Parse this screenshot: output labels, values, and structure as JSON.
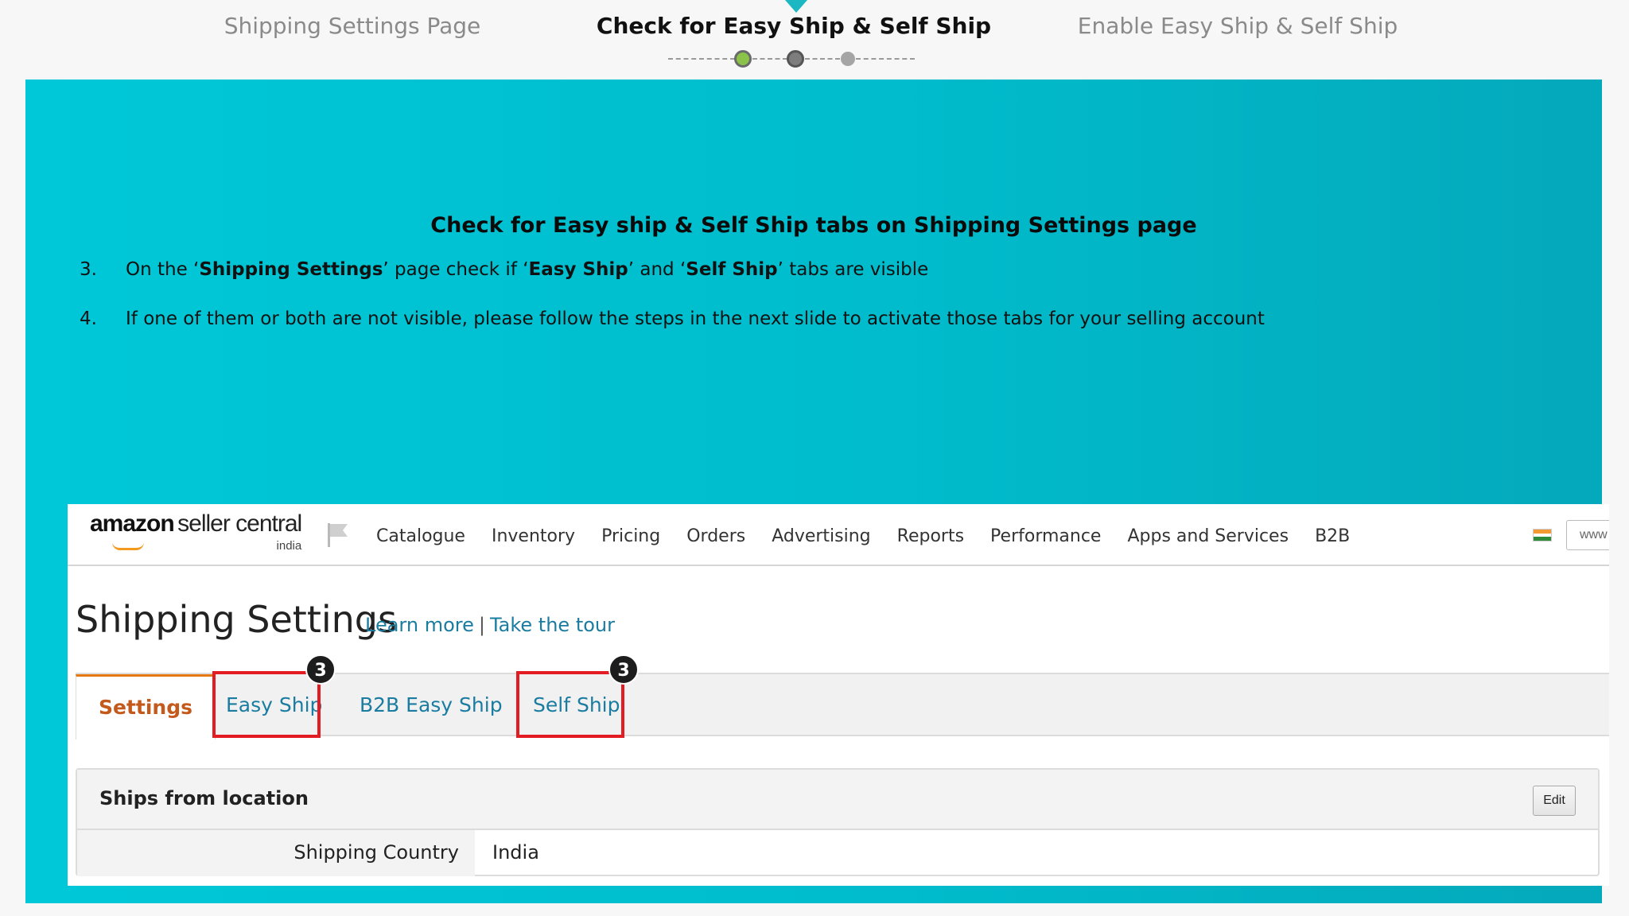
{
  "stepper": {
    "steps": [
      {
        "label": "Shipping Settings Page",
        "state": "done"
      },
      {
        "label": "Check for Easy Ship & Self Ship",
        "state": "current"
      },
      {
        "label": "Enable Easy Ship & Self Ship",
        "state": "todo"
      }
    ]
  },
  "slide": {
    "heading": "Check for Easy ship & Self Ship tabs on Shipping Settings page",
    "instructions": [
      {
        "num": "3.",
        "parts": [
          "On the ‘",
          "Shipping Settings",
          "’ page check if ‘",
          "Easy Ship",
          "’ and ‘",
          "Self Ship",
          "’ tabs are visible"
        ]
      },
      {
        "num": "4.",
        "text": "If one of them or both are not visible, please follow the steps in the next slide to activate those tabs for your selling account"
      }
    ]
  },
  "seller_central": {
    "logo_brand": "amazon",
    "logo_product": "seller central",
    "logo_region": "india",
    "nav": [
      "Catalogue",
      "Inventory",
      "Pricing",
      "Orders",
      "Advertising",
      "Reports",
      "Performance",
      "Apps and Services",
      "B2B"
    ],
    "search_value": "www",
    "page_title": "Shipping Settings",
    "learn_more": "Learn more",
    "separator": "|",
    "take_tour": "Take the tour",
    "tabs": [
      "Settings",
      "Easy Ship",
      "B2B Easy Ship",
      "Self Ship"
    ],
    "active_tab": "Settings",
    "callout_badge": "3",
    "panel_title": "Ships from location",
    "edit_label": "Edit",
    "row_label": "Shipping Country",
    "row_value": "India"
  },
  "colors": {
    "slide_teal": "#00c8d8",
    "highlight_red": "#e31b23",
    "link_blue": "#1a7ca0",
    "active_tab_orange": "#c35a1c",
    "step_done_green": "#8bc34a"
  }
}
